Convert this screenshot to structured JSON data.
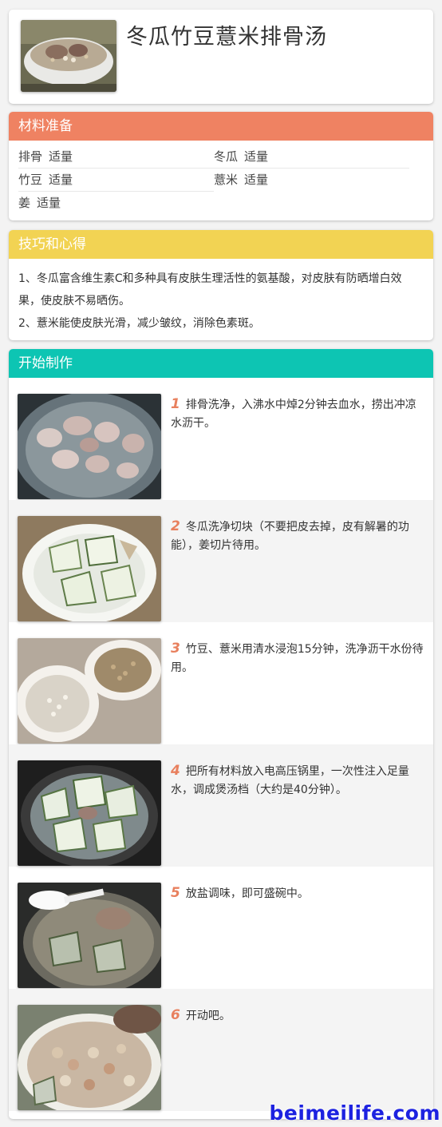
{
  "recipe": {
    "title": "冬瓜竹豆薏米排骨汤",
    "thumbnail_icon": "soup-bowl-photo"
  },
  "ingredients": {
    "heading": "材料准备",
    "color": "#ef8262",
    "items": [
      {
        "name": "排骨",
        "qty": "适量"
      },
      {
        "name": "冬瓜",
        "qty": "适量"
      },
      {
        "name": "竹豆",
        "qty": "适量"
      },
      {
        "name": "薏米",
        "qty": "适量"
      },
      {
        "name": "姜",
        "qty": "适量"
      }
    ]
  },
  "tips": {
    "heading": "技巧和心得",
    "color": "#f2d353",
    "lines": [
      "1、冬瓜富含维生素C和多种具有皮肤生理活性的氨基酸，对皮肤有防晒增白效果，使皮肤不易晒伤。",
      "2、薏米能使皮肤光滑，减少皱纹，消除色素斑。"
    ]
  },
  "steps": {
    "heading": "开始制作",
    "color": "#0dc5b3",
    "items": [
      {
        "num": "1",
        "text": "排骨洗净，入沸水中焯2分钟去血水，捞出冲凉水沥干。",
        "photo": "ribs-in-water-photo"
      },
      {
        "num": "2",
        "text": "冬瓜洗净切块（不要把皮去掉，皮有解暑的功能），姜切片待用。",
        "photo": "winter-melon-plate-photo"
      },
      {
        "num": "3",
        "text": "竹豆、薏米用清水浸泡15分钟，洗净沥干水份待用。",
        "photo": "beans-bowls-photo"
      },
      {
        "num": "4",
        "text": "把所有材料放入电高压锅里，一次性注入足量水，调成煲汤档（大约是40分钟）。",
        "photo": "pressure-cooker-photo"
      },
      {
        "num": "5",
        "text": "放盐调味，即可盛碗中。",
        "photo": "seasoning-spoon-photo"
      },
      {
        "num": "6",
        "text": "开动吧。",
        "photo": "served-soup-photo"
      }
    ]
  },
  "watermark": "beimeilife.com"
}
